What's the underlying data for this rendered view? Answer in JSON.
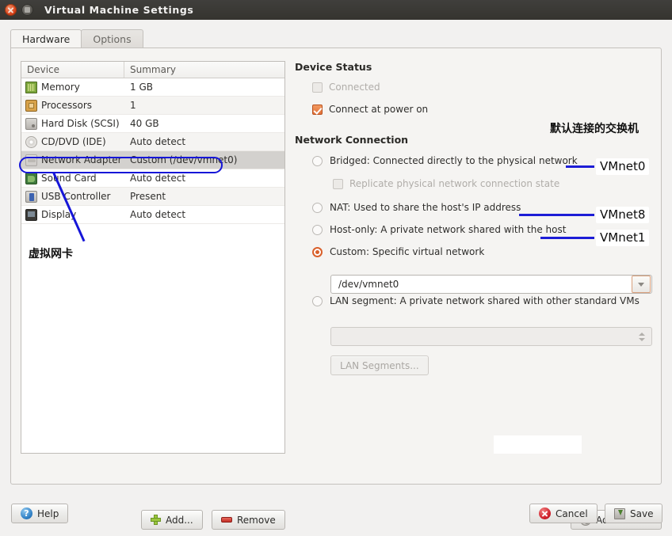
{
  "window": {
    "title": "Virtual Machine Settings",
    "close_icon": "close-icon",
    "minimize_icon": "minimize-icon"
  },
  "tabs": [
    {
      "label": "Hardware",
      "active": true
    },
    {
      "label": "Options",
      "active": false
    }
  ],
  "device_table": {
    "headers": [
      "Device",
      "Summary"
    ],
    "rows": [
      {
        "icon": "memory-icon",
        "device": "Memory",
        "summary": "1 GB"
      },
      {
        "icon": "cpu-icon",
        "device": "Processors",
        "summary": "1"
      },
      {
        "icon": "harddisk-icon",
        "device": "Hard Disk (SCSI)",
        "summary": "40 GB"
      },
      {
        "icon": "cddvd-icon",
        "device": "CD/DVD (IDE)",
        "summary": "Auto detect"
      },
      {
        "icon": "network-icon",
        "device": "Network Adapter",
        "summary": "Custom (/dev/vmnet0)"
      },
      {
        "icon": "soundcard-icon",
        "device": "Sound Card",
        "summary": "Auto detect"
      },
      {
        "icon": "usb-icon",
        "device": "USB Controller",
        "summary": "Present"
      },
      {
        "icon": "display-icon",
        "device": "Display",
        "summary": "Auto detect"
      }
    ],
    "selected_index": 4
  },
  "left_buttons": {
    "add": "Add...",
    "remove": "Remove"
  },
  "device_status": {
    "title": "Device Status",
    "connected": {
      "label": "Connected",
      "checked": false,
      "enabled": false
    },
    "connect_at_power_on": {
      "label": "Connect at power on",
      "checked": true,
      "enabled": true
    }
  },
  "network_connection": {
    "title": "Network Connection",
    "options": [
      {
        "label": "Bridged: Connected directly to the physical network",
        "selected": false
      },
      {
        "label": "NAT: Used to share the host's IP address",
        "selected": false
      },
      {
        "label": "Host-only: A private network shared with the host",
        "selected": false
      },
      {
        "label": "Custom: Specific virtual network",
        "selected": true
      },
      {
        "label": "LAN segment: A private network shared with other standard VMs",
        "selected": false
      }
    ],
    "replicate_state": {
      "label": "Replicate physical network connection state",
      "checked": false,
      "enabled": false
    },
    "custom_network_value": "/dev/vmnet0",
    "lan_segment_value": "",
    "lan_segments_button": "LAN Segments...",
    "advanced_button": "Advanced..."
  },
  "annotations": {
    "accent_color": "#1d1dd6",
    "switch_note": "默认连接的交换机",
    "vnic_note": "虚拟网卡",
    "vmnet_labels": [
      "VMnet0",
      "VMnet8",
      "VMnet1"
    ]
  },
  "footer": {
    "help": "Help",
    "help_icon_glyph": "?",
    "cancel": "Cancel",
    "save": "Save"
  }
}
